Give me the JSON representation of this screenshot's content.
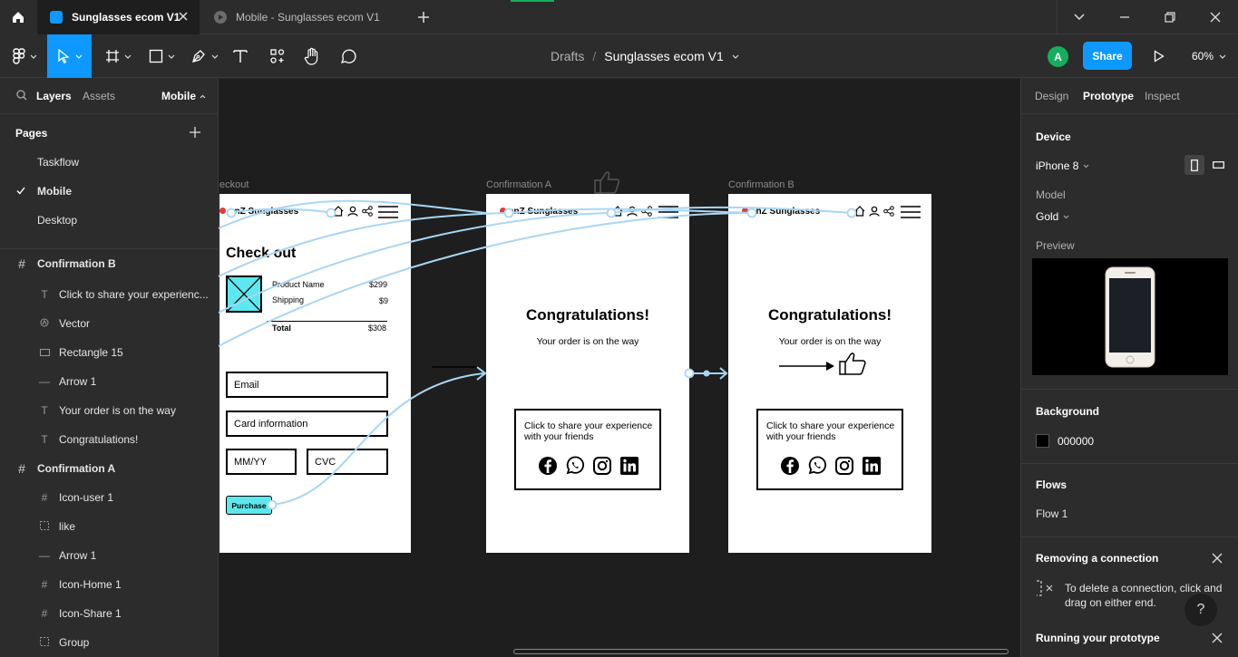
{
  "tabs": [
    {
      "label": "Sunglasses ecom V1",
      "active": true
    },
    {
      "label": "Mobile - Sunglasses ecom V1",
      "active": false
    }
  ],
  "toolbar": {
    "breadcrumb_parent": "Drafts",
    "breadcrumb_sep": "/",
    "file_name": "Sunglasses ecom V1",
    "avatar_letter": "A",
    "share_label": "Share",
    "zoom": "60%"
  },
  "left": {
    "tab_layers": "Layers",
    "tab_assets": "Assets",
    "page_selector": "Mobile",
    "pages_title": "Pages",
    "pages": [
      {
        "label": "Taskflow",
        "checked": false
      },
      {
        "label": "Mobile",
        "checked": true
      },
      {
        "label": "Desktop",
        "checked": false
      }
    ],
    "layers": [
      {
        "label": "Confirmation B",
        "icon": "frame-icon",
        "frame": true
      },
      {
        "label": "Click to share your experienc...",
        "icon": "text-icon"
      },
      {
        "label": "Vector",
        "icon": "vector-icon"
      },
      {
        "label": "Rectangle 15",
        "icon": "rectangle-icon"
      },
      {
        "label": "Arrow 1",
        "icon": "line-icon"
      },
      {
        "label": "Your order is on the way",
        "icon": "text-icon"
      },
      {
        "label": "Congratulations!",
        "icon": "text-icon"
      },
      {
        "label": "Confirmation A",
        "icon": "frame-icon",
        "frame": true
      },
      {
        "label": "Icon-user 1",
        "icon": "frame-icon"
      },
      {
        "label": "like",
        "icon": "group-icon"
      },
      {
        "label": "Arrow 1",
        "icon": "line-icon"
      },
      {
        "label": "Icon-Home 1",
        "icon": "frame-icon"
      },
      {
        "label": "Icon-Share 1",
        "icon": "frame-icon"
      },
      {
        "label": "Group",
        "icon": "group-icon"
      }
    ]
  },
  "canvas": {
    "frames": {
      "checkout_label": "eckout",
      "confA_label": "Confirmation A",
      "confB_label": "Confirmation B"
    },
    "brand": "enZ Sunglasses",
    "checkout": {
      "title": "Check out",
      "product_name": "Product Name",
      "product_price": "$299",
      "shipping": "Shipping",
      "shipping_price": "$9",
      "total": "Total",
      "total_price": "$308",
      "email": "Email",
      "card": "Card information",
      "mmyy": "MM/YY",
      "cvc": "CVC",
      "purchase": "Purchase"
    },
    "confirmation": {
      "title": "Congratulations!",
      "subtitle": "Your order is on the way",
      "share_text": "Click to share your experience with your friends"
    }
  },
  "right": {
    "tabs": [
      "Design",
      "Prototype",
      "Inspect"
    ],
    "device_title": "Device",
    "device_value": "iPhone 8",
    "model_title": "Model",
    "model_value": "Gold",
    "preview_title": "Preview",
    "background_title": "Background",
    "background_value": "000000",
    "flows_title": "Flows",
    "flow_item": "Flow 1",
    "removing_title": "Removing a connection",
    "removing_text": "To delete a connection, click and drag on either end.",
    "running_title": "Running your prototype",
    "help": "?"
  },
  "colors": {
    "accent": "#0d99ff",
    "avatar": "#14ae5c",
    "connection": "#9fd0f0",
    "purchase": "#5ce8ee",
    "placeholder_img": "#5ce8ee"
  }
}
